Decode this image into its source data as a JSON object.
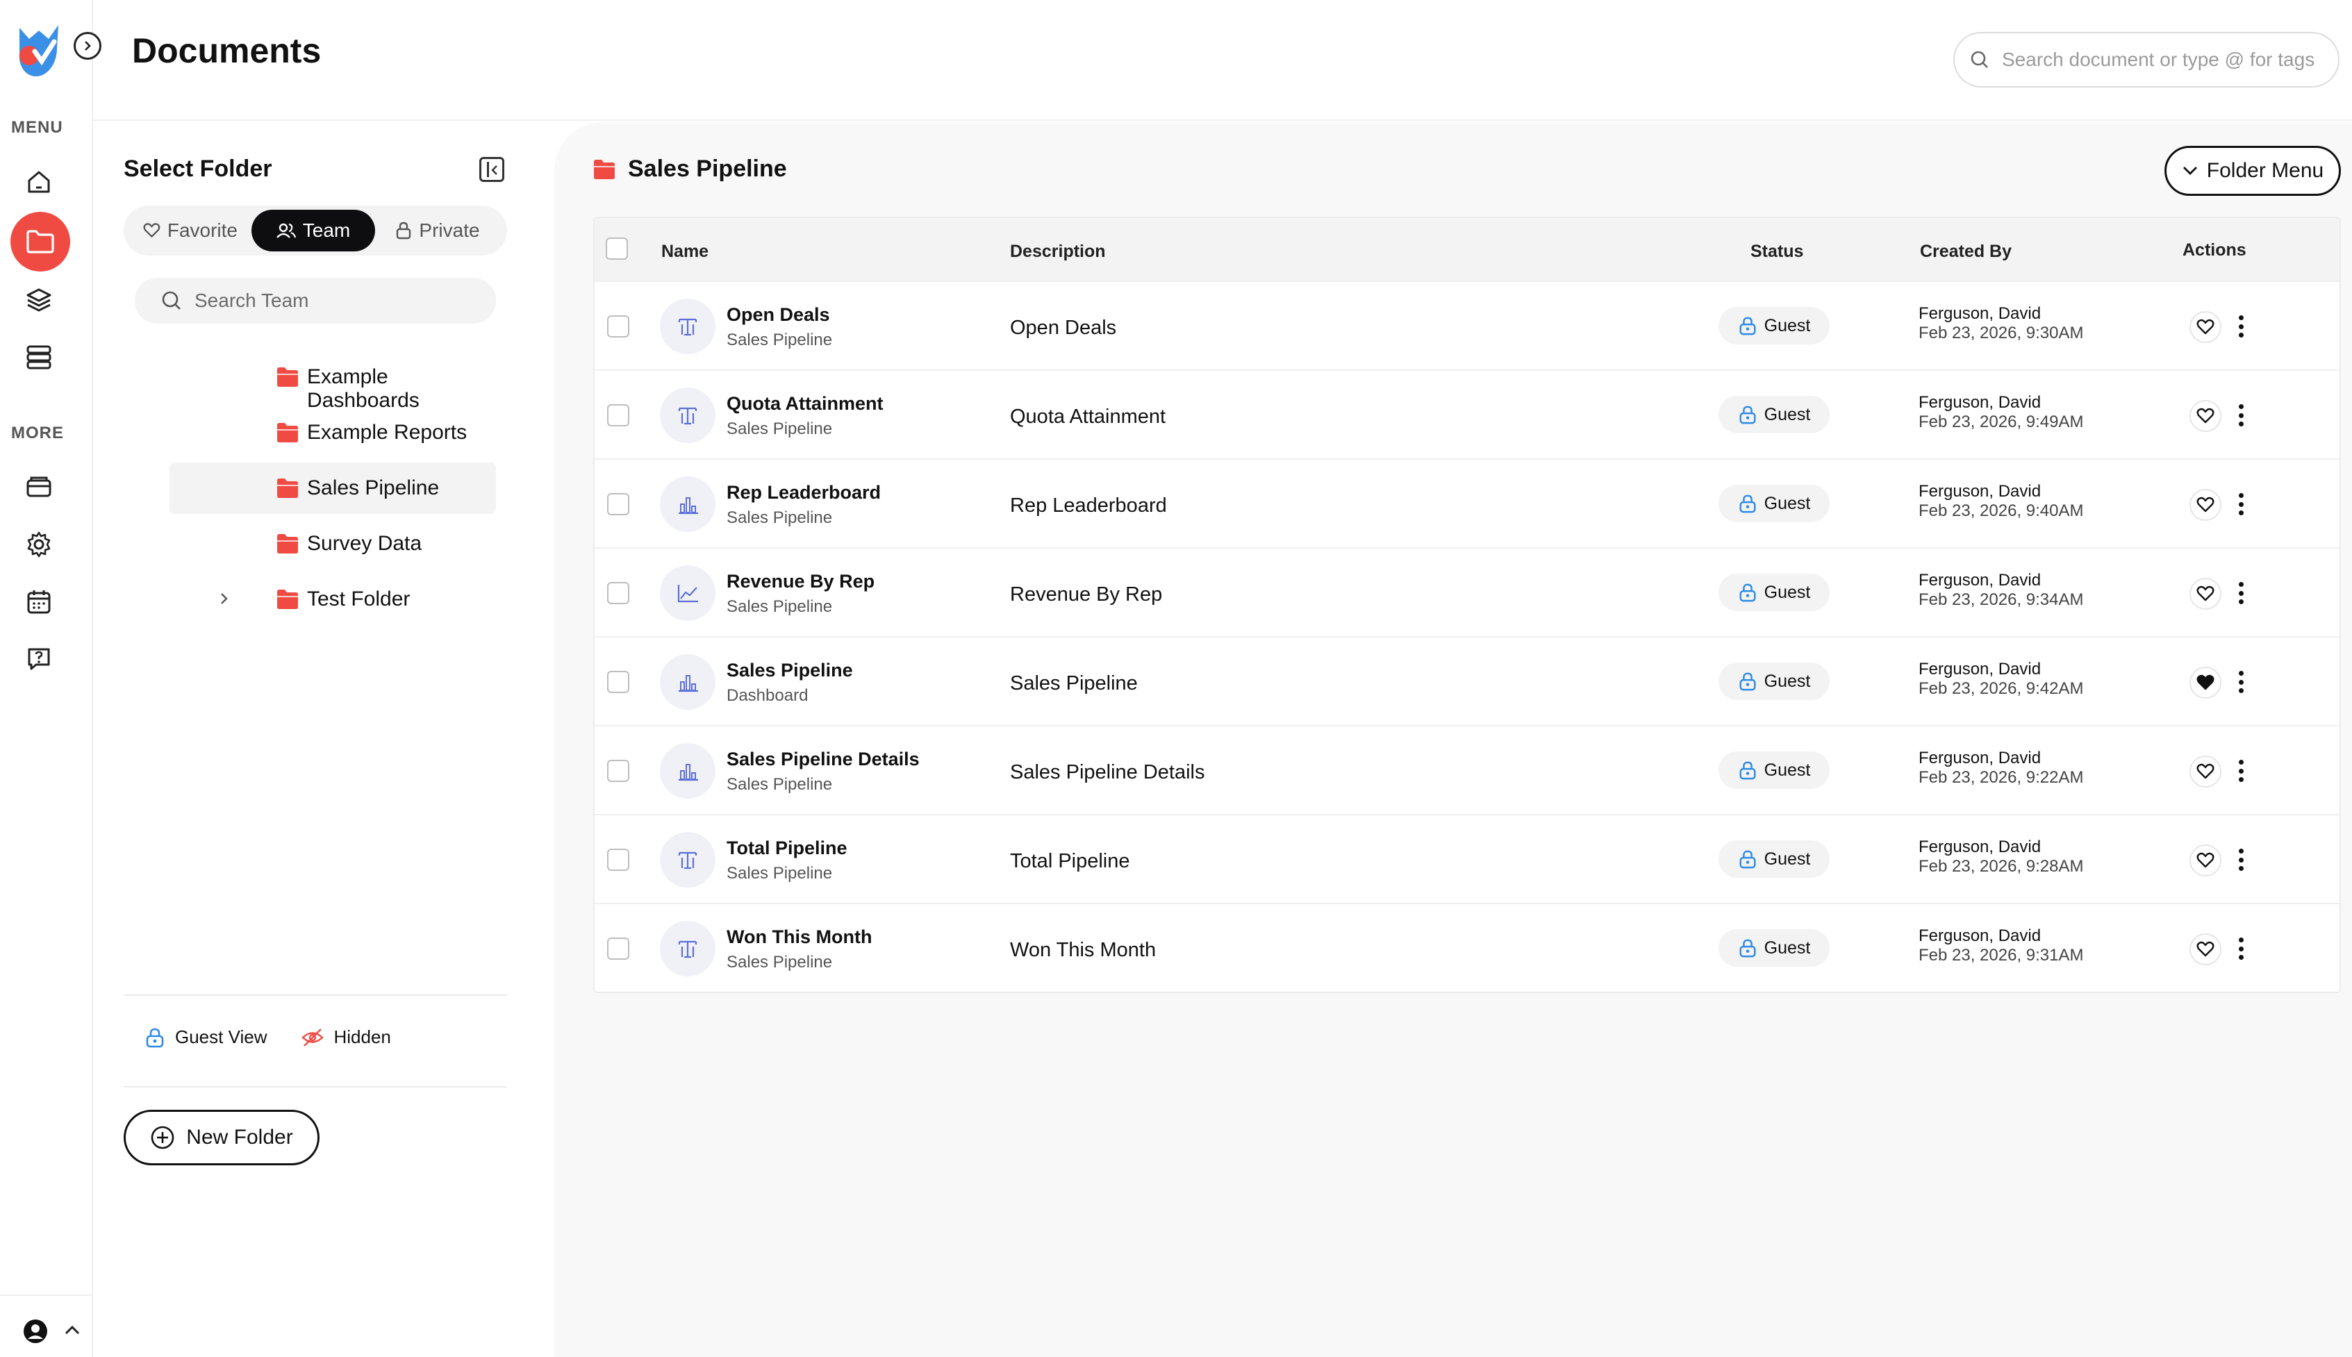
{
  "header": {
    "title": "Documents",
    "search_placeholder": "Search document or type @ for tags"
  },
  "rail": {
    "menu_label": "MENU",
    "more_label": "MORE",
    "menu_items": [
      "home-icon",
      "folder-icon",
      "layers-icon",
      "server-icon"
    ],
    "more_items": [
      "cards-icon",
      "gear-icon",
      "calendar-icon",
      "help-icon"
    ],
    "accent": "#ef4b43"
  },
  "folder_panel": {
    "title": "Select Folder",
    "tabs": [
      {
        "label": "Favorite",
        "icon": "heart-icon",
        "active": false
      },
      {
        "label": "Team",
        "icon": "users-icon",
        "active": true
      },
      {
        "label": "Private",
        "icon": "lock-icon",
        "active": false
      }
    ],
    "search_placeholder": "Search Team",
    "folders": [
      {
        "label": "Example Dashboards",
        "selected": false,
        "expandable": false
      },
      {
        "label": "Example Reports",
        "selected": false,
        "expandable": false
      },
      {
        "label": "Sales Pipeline",
        "selected": true,
        "expandable": false
      },
      {
        "label": "Survey Data",
        "selected": false,
        "expandable": false
      },
      {
        "label": "Test Folder",
        "selected": false,
        "expandable": true
      }
    ],
    "legend": {
      "guest_view": "Guest View",
      "hidden": "Hidden"
    },
    "new_folder_label": "New Folder"
  },
  "main": {
    "folder_title": "Sales Pipeline",
    "folder_menu_label": "Folder Menu",
    "columns": {
      "name": "Name",
      "description": "Description",
      "status": "Status",
      "created_by": "Created By",
      "actions": "Actions"
    },
    "rows": [
      {
        "name": "Open Deals",
        "sub": "Sales Pipeline",
        "desc": "Open Deals",
        "status": "Guest",
        "creator": "Ferguson, David",
        "date": "Feb 23, 2026, 9:30AM",
        "type": "text-icon",
        "favorite": false
      },
      {
        "name": "Quota Attainment",
        "sub": "Sales Pipeline",
        "desc": "Quota Attainment",
        "status": "Guest",
        "creator": "Ferguson, David",
        "date": "Feb 23, 2026, 9:49AM",
        "type": "text-icon",
        "favorite": false
      },
      {
        "name": "Rep Leaderboard",
        "sub": "Sales Pipeline",
        "desc": "Rep Leaderboard",
        "status": "Guest",
        "creator": "Ferguson, David",
        "date": "Feb 23, 2026, 9:40AM",
        "type": "bar-chart-icon",
        "favorite": false
      },
      {
        "name": "Revenue By Rep",
        "sub": "Sales Pipeline",
        "desc": "Revenue By Rep",
        "status": "Guest",
        "creator": "Ferguson, David",
        "date": "Feb 23, 2026, 9:34AM",
        "type": "line-chart-icon",
        "favorite": false
      },
      {
        "name": "Sales Pipeline",
        "sub": "Dashboard",
        "desc": "Sales Pipeline",
        "status": "Guest",
        "creator": "Ferguson, David",
        "date": "Feb 23, 2026, 9:42AM",
        "type": "bar-chart-icon",
        "favorite": true
      },
      {
        "name": "Sales Pipeline Details",
        "sub": "Sales Pipeline",
        "desc": "Sales Pipeline Details",
        "status": "Guest",
        "creator": "Ferguson, David",
        "date": "Feb 23, 2026, 9:22AM",
        "type": "bar-chart-icon",
        "favorite": false
      },
      {
        "name": "Total Pipeline",
        "sub": "Sales Pipeline",
        "desc": "Total Pipeline",
        "status": "Guest",
        "creator": "Ferguson, David",
        "date": "Feb 23, 2026, 9:28AM",
        "type": "text-icon",
        "favorite": false
      },
      {
        "name": "Won This Month",
        "sub": "Sales Pipeline",
        "desc": "Won This Month",
        "status": "Guest",
        "creator": "Ferguson, David",
        "date": "Feb 23, 2026, 9:31AM",
        "type": "text-icon",
        "favorite": false
      }
    ]
  }
}
